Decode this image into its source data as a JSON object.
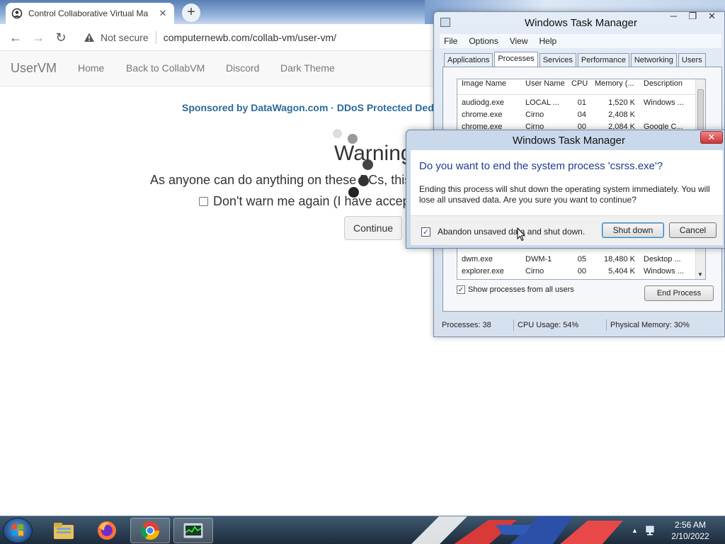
{
  "browser": {
    "tab_title": "Control Collaborative Virtual Ma",
    "security_label": "Not secure",
    "url": "computernewb.com/collab-vm/user-vm/"
  },
  "site": {
    "brand": "UserVM",
    "nav": [
      "Home",
      "Back to CollabVM",
      "Discord",
      "Dark Theme"
    ],
    "sponsor": "Sponsored by DataWagon.com · DDoS Protected Ded",
    "warning_heading": "Warning",
    "warning_text": "As anyone can do anything on these PCs, this",
    "dont_warn_label": "Don't warn me again (I have accep",
    "continue_label": "Continue"
  },
  "task_manager": {
    "title": "Windows Task Manager",
    "menu": [
      "File",
      "Options",
      "View",
      "Help"
    ],
    "tabs": [
      "Applications",
      "Processes",
      "Services",
      "Performance",
      "Networking",
      "Users"
    ],
    "active_tab": "Processes",
    "columns": [
      "Image Name",
      "User Name",
      "CPU",
      "Memory (...",
      "Description"
    ],
    "rows_top": [
      [
        "audiodg.exe",
        "LOCAL ...",
        "01",
        "1,520 K",
        "Windows ..."
      ],
      [
        "chrome.exe",
        "Cirno",
        "04",
        "2,408 K",
        ""
      ],
      [
        "chrome.exe",
        "Cirno",
        "00",
        "2,084 K",
        "Google C..."
      ]
    ],
    "rows_bottom": [
      [
        "dwm.exe",
        "DWM-1",
        "05",
        "18,480 K",
        "Desktop ..."
      ],
      [
        "explorer.exe",
        "Cirno",
        "00",
        "5,404 K",
        "Windows ..."
      ]
    ],
    "show_all_label": "Show processes from all users",
    "end_process_label": "End Process",
    "status": {
      "processes": "Processes: 38",
      "cpu": "CPU Usage: 54%",
      "memory": "Physical Memory: 30%"
    }
  },
  "dialog": {
    "title": "Windows Task Manager",
    "heading": "Do you want to end the system process 'csrss.exe'?",
    "message": "Ending this process will shut down the operating system immediately.  You will lose all unsaved data.  Are you sure you want to continue?",
    "abandon_label": "Abandon unsaved data and shut down.",
    "abandon_checked": true,
    "shutdown_label": "Shut down",
    "cancel_label": "Cancel"
  },
  "taskbar": {
    "time": "2:56 AM",
    "date": "2/10/2022",
    "apps": [
      "explorer-icon",
      "firefox-icon",
      "chrome-icon",
      "task-manager-icon"
    ]
  },
  "colors": {
    "sponsor_link": "#2a6a9a",
    "dialog_heading": "#1c3c8c",
    "taskbar": "#1d2c3c"
  }
}
